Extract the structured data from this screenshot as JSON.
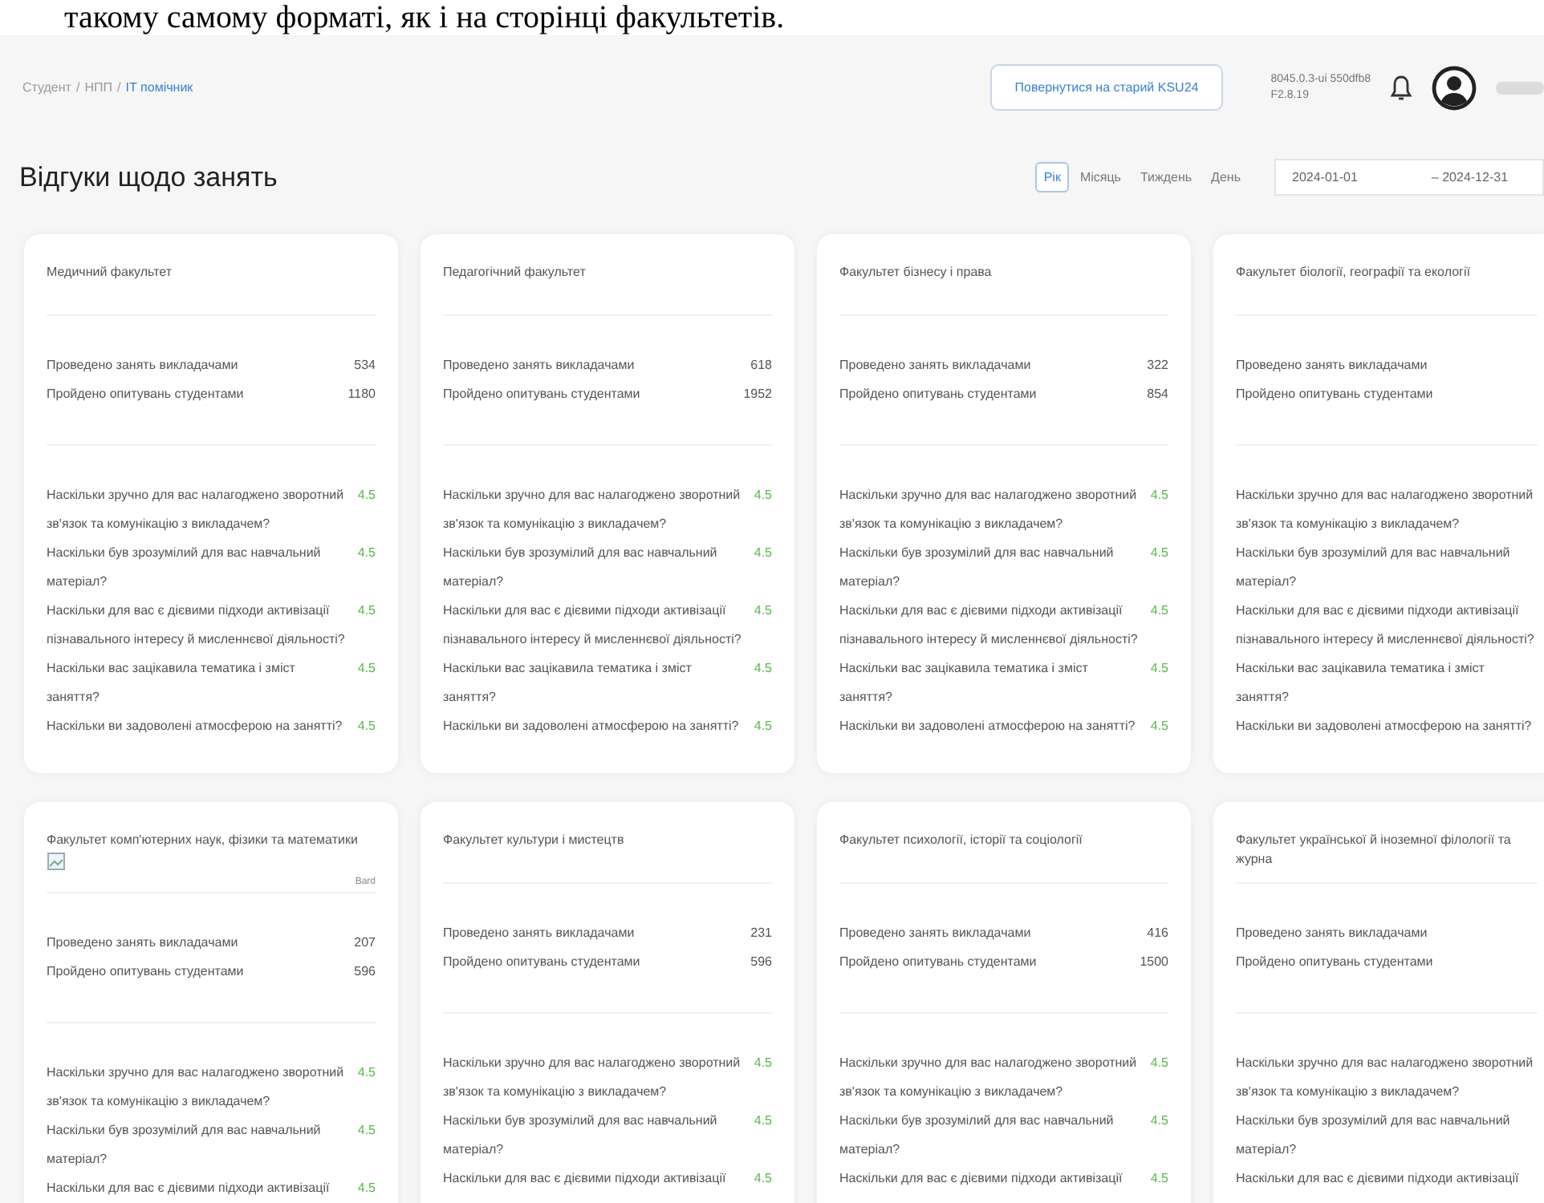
{
  "document_text": "такому самому форматі, як і на сторінці факультетів.",
  "header": {
    "breadcrumb": [
      {
        "label": "Студент",
        "current": false
      },
      {
        "label": "НПП",
        "current": false
      },
      {
        "label": "ІТ помічник",
        "current": true
      }
    ],
    "separator": "/",
    "back_button": "Повернутися на старий KSU24",
    "version": [
      "8045.0.3-ui 550dfb8",
      "F2.8.19"
    ]
  },
  "page_title": "Відгуки щодо занять",
  "period_tabs": [
    {
      "label": "Рік",
      "selected": true
    },
    {
      "label": "Місяць",
      "selected": false
    },
    {
      "label": "Тиждень",
      "selected": false
    },
    {
      "label": "День",
      "selected": false
    }
  ],
  "date_range": {
    "from": "2024-01-01",
    "to": "– 2024-12-31"
  },
  "cards": [
    {
      "title": "Медичний факультет",
      "stats": [
        {
          "label": "Проведено занять викладачами",
          "value": "534"
        },
        {
          "label": "Пройдено опитувань студентами",
          "value": "1180"
        }
      ],
      "questions": [
        {
          "text": "Наскільки зручно для вас налагоджено зворотний зв'язок та комунікацію з викладачем?",
          "score": "4.5"
        },
        {
          "text": "Наскільки був зрозумілий для вас навчальний матеріал?",
          "score": "4.5"
        },
        {
          "text": "Наскільки для вас є дієвими підходи активізації пізнавального інтересу й мисленнєвої діяльності?",
          "score": "4.5"
        },
        {
          "text": "Наскільки вас зацікавила тематика і зміст заняття?",
          "score": "4.5"
        },
        {
          "text": "Наскільки ви задоволені атмосферою на занятті?",
          "score": "4.5"
        }
      ]
    },
    {
      "title": "Педагогічний факультет",
      "stats": [
        {
          "label": "Проведено занять викладачами",
          "value": "618"
        },
        {
          "label": "Пройдено опитувань студентами",
          "value": "1952"
        }
      ],
      "questions": [
        {
          "text": "Наскільки зручно для вас налагоджено зворотний зв'язок та комунікацію з викладачем?",
          "score": "4.5"
        },
        {
          "text": "Наскільки був зрозумілий для вас навчальний матеріал?",
          "score": "4.5"
        },
        {
          "text": "Наскільки для вас є дієвими підходи активізації пізнавального інтересу й мисленнєвої діяльності?",
          "score": "4.5"
        },
        {
          "text": "Наскільки вас зацікавила тематика і зміст заняття?",
          "score": "4.5"
        },
        {
          "text": "Наскільки ви задоволені атмосферою на занятті?",
          "score": "4.5"
        }
      ]
    },
    {
      "title": "Факультет бізнесу і права",
      "stats": [
        {
          "label": "Проведено занять викладачами",
          "value": "322"
        },
        {
          "label": "Пройдено опитувань студентами",
          "value": "854"
        }
      ],
      "questions": [
        {
          "text": "Наскільки зручно для вас налагоджено зворотний зв'язок та комунікацію з викладачем?",
          "score": "4.5"
        },
        {
          "text": "Наскільки був зрозумілий для вас навчальний матеріал?",
          "score": "4.5"
        },
        {
          "text": "Наскільки для вас є дієвими підходи активізації пізнавального інтересу й мисленнєвої діяльності?",
          "score": "4.5"
        },
        {
          "text": "Наскільки вас зацікавила тематика і зміст заняття?",
          "score": "4.5"
        },
        {
          "text": "Наскільки ви задоволені атмосферою на занятті?",
          "score": "4.5"
        }
      ]
    },
    {
      "title": "Факультет біології, географії та екології",
      "stats": [
        {
          "label": "Проведено занять викладачами"
        },
        {
          "label": "Пройдено опитувань студентами"
        }
      ],
      "questions": [
        {
          "text": "Наскільки зручно для вас налагоджено зворотний зв'язок та комунікацію з викладачем?"
        },
        {
          "text": "Наскільки був зрозумілий для вас навчальний матеріал?"
        },
        {
          "text": "Наскільки для вас є дієвими підходи активізації пізнавального інтересу й мисленнєвої діяльності?"
        },
        {
          "text": "Наскільки вас зацікавила тематика і зміст заняття?"
        },
        {
          "text": "Наскільки ви задоволені атмосферою на занятті?"
        }
      ]
    },
    {
      "title": "Факультет комп'ютерних наук, фізики та математики",
      "image_alt": "Bard",
      "stats": [
        {
          "label": "Проведено занять викладачами",
          "value": "207"
        },
        {
          "label": "Пройдено опитувань студентами",
          "value": "596"
        }
      ],
      "questions": [
        {
          "text": "Наскільки зручно для вас налагоджено зворотний зв'язок та комунікацію з викладачем?",
          "score": "4.5"
        },
        {
          "text": "Наскільки був зрозумілий для вас навчальний матеріал?",
          "score": "4.5"
        },
        {
          "text": "Наскільки для вас є дієвими підходи активізації",
          "score": "4.5"
        }
      ]
    },
    {
      "title": "Факультет культури і мистецтв",
      "stats": [
        {
          "label": "Проведено занять викладачами",
          "value": "231"
        },
        {
          "label": "Пройдено опитувань студентами",
          "value": "596"
        }
      ],
      "questions": [
        {
          "text": "Наскільки зручно для вас налагоджено зворотний зв'язок та комунікацію з викладачем?",
          "score": "4.5"
        },
        {
          "text": "Наскільки був зрозумілий для вас навчальний матеріал?",
          "score": "4.5"
        },
        {
          "text": "Наскільки для вас є дієвими підходи активізації",
          "score": "4.5"
        }
      ]
    },
    {
      "title": "Факультет психології, історії та соціології",
      "stats": [
        {
          "label": "Проведено занять викладачами",
          "value": "416"
        },
        {
          "label": "Пройдено опитувань студентами",
          "value": "1500"
        }
      ],
      "questions": [
        {
          "text": "Наскільки зручно для вас налагоджено зворотний зв'язок та комунікацію з викладачем?",
          "score": "4.5"
        },
        {
          "text": "Наскільки був зрозумілий для вас навчальний матеріал?",
          "score": "4.5"
        },
        {
          "text": "Наскільки для вас є дієвими підходи активізації",
          "score": "4.5"
        }
      ]
    },
    {
      "title": "Факультет української й іноземної філології та журна",
      "stats": [
        {
          "label": "Проведено занять викладачами"
        },
        {
          "label": "Пройдено опитувань студентами"
        }
      ],
      "questions": [
        {
          "text": "Наскільки зручно для вас налагоджено зворотний зв'язок та комунікацію з викладачем?"
        },
        {
          "text": "Наскільки був зрозумілий для вас навчальний матеріал?"
        },
        {
          "text": "Наскільки для вас є дієвими підходи активізації"
        }
      ]
    }
  ]
}
